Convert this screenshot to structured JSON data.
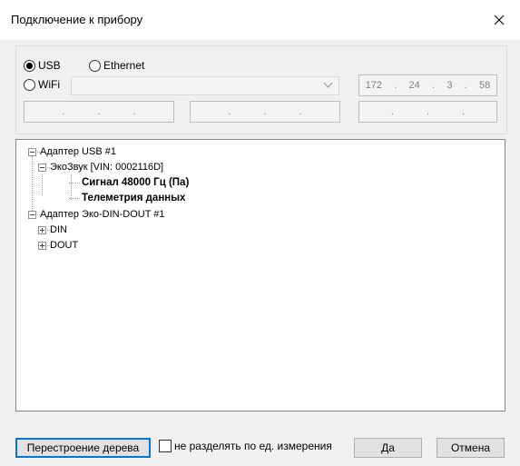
{
  "window": {
    "title": "Подключение к прибору"
  },
  "connection": {
    "usb_label": "USB",
    "usb_selected": true,
    "ethernet_label": "Ethernet",
    "wifi_label": "WiFi",
    "wifi_combo_value": "",
    "ip_address": {
      "o1": "172",
      "o2": "24",
      "o3": "3",
      "o4": "58"
    },
    "empty_ip_dots": "."
  },
  "tree": {
    "adapter_usb": "Адаптер USB #1",
    "ecozvuk": "ЭкоЗвук [VIN: 0002116D]",
    "signal": "Сигнал 48000 Гц (Па)",
    "telemetry": "Телеметрия данных",
    "adapter_din_dout": "Адаптер Эко-DIN-DOUT #1",
    "din": "DIN",
    "dout": "DOUT"
  },
  "footer": {
    "rebuild_label": "Перестроение дерева",
    "no_split_label": "не разделять по ед. измерения",
    "no_split_checked": false,
    "ok_label": "Да",
    "cancel_label": "Отмена"
  },
  "icons": {
    "close": "close-icon",
    "dropdown": "chevron-down-icon",
    "collapse": "minus-expander-icon",
    "expand": "plus-expander-icon"
  }
}
